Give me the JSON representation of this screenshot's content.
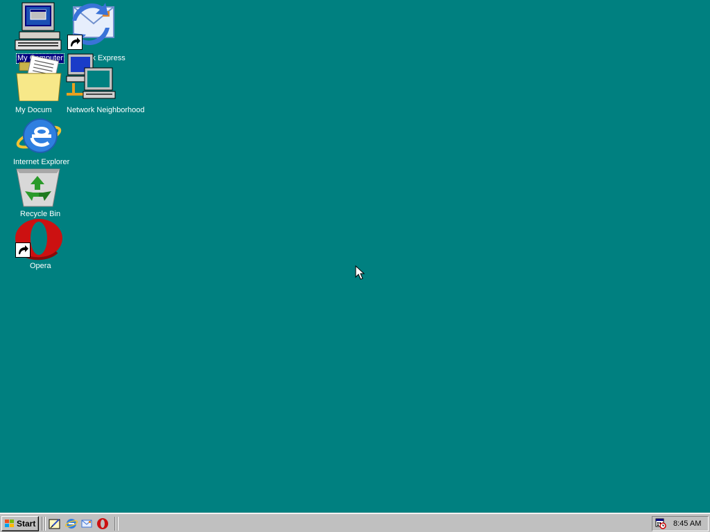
{
  "desktop": {
    "background": "#008080",
    "icons": [
      {
        "label": "My Computer",
        "icon": "my-computer-icon",
        "selected": true
      },
      {
        "label": "Outlook Express",
        "icon": "outlook-express-icon",
        "shortcut": true
      },
      {
        "label": "My Documents",
        "icon": "my-documents-icon"
      },
      {
        "label": "Network Neighborhood",
        "icon": "network-neighborhood-icon"
      },
      {
        "label": "Internet Explorer",
        "icon": "internet-explorer-icon"
      },
      {
        "label": "Recycle Bin",
        "icon": "recycle-bin-icon"
      },
      {
        "label": "Opera",
        "icon": "opera-icon",
        "shortcut": true
      }
    ]
  },
  "taskbar": {
    "start_label": "Start",
    "quick_launch": [
      {
        "icon": "show-desktop-icon"
      },
      {
        "icon": "internet-explorer-icon"
      },
      {
        "icon": "outlook-express-icon"
      },
      {
        "icon": "opera-icon"
      }
    ],
    "tray": {
      "icon": "task-scheduler-icon",
      "clock": "8:45 AM"
    }
  }
}
